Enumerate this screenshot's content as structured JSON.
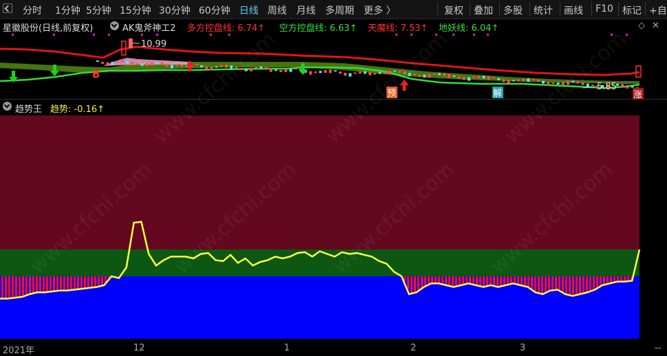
{
  "toolbar": {
    "left_items": [
      "分时",
      "1分钟",
      "5分钟",
      "15分钟",
      "30分钟",
      "60分钟",
      "日线",
      "周线",
      "月线",
      "多周期",
      "更多 〉"
    ],
    "active": "日线",
    "right_items": [
      "复权",
      "叠加",
      "多股",
      "统计",
      "画线",
      "F10",
      "标记",
      "+自"
    ]
  },
  "info": {
    "stock": "星徽股份(日线,前复权)",
    "indicator_name": "AK鬼斧神工2",
    "dfk_label": "多方控盘线: 6.74↑",
    "kfk_label": "空方控盘线: 6.63↑",
    "tmx_label": "天魔线: 7.53↑",
    "dyx_label": "地妖线: 6.04↑"
  },
  "price_annotations": {
    "high": "10.99",
    "low": "5.85",
    "buy_mark": "B",
    "pre_mark": "预",
    "jie_mark": "解",
    "zhang_mark": "涨"
  },
  "indicator": {
    "name": "趋势王",
    "value_label": "趋势: -0.16↑"
  },
  "axis": {
    "labels": [
      "2021年",
      "12",
      "1",
      "2",
      "3",
      "--"
    ]
  },
  "colors": {
    "zone_top": "#64081f",
    "zone_mid": "#0c5712",
    "zone_bottom": "#0000ff",
    "trend_line": "#ffff40",
    "tick_red": "#ff1010",
    "red_line": "#e01515",
    "green_line": "#33dd33"
  },
  "chart_data": {
    "type": "line",
    "series": [
      {
        "values": [
          -0.55,
          -0.55,
          -0.54,
          -0.53,
          -0.5,
          -0.48,
          -0.48,
          -0.47,
          -0.46,
          -0.46,
          -0.45,
          -0.44,
          -0.43,
          -0.42,
          -0.4,
          -0.3,
          -0.32,
          -0.2,
          0.3,
          0.31,
          -0.05,
          -0.18,
          -0.12,
          -0.08,
          -0.08,
          -0.08,
          -0.1,
          -0.05,
          -0.04,
          -0.12,
          -0.13,
          -0.06,
          -0.15,
          -0.1,
          -0.18,
          -0.14,
          -0.12,
          -0.08,
          -0.1,
          -0.08,
          -0.04,
          -0.03,
          -0.08,
          -0.02,
          -0.05,
          -0.08,
          -0.03,
          -0.05,
          -0.04,
          -0.06,
          -0.08,
          -0.13,
          -0.16,
          -0.25,
          -0.3,
          -0.5,
          -0.48,
          -0.42,
          -0.38,
          -0.38,
          -0.4,
          -0.42,
          -0.4,
          -0.38,
          -0.4,
          -0.42,
          -0.4,
          -0.42,
          -0.4,
          -0.38,
          -0.4,
          -0.42,
          -0.48,
          -0.5,
          -0.46,
          -0.45,
          -0.5,
          -0.52,
          -0.5,
          -0.48,
          -0.45,
          -0.4,
          -0.38,
          -0.36,
          -0.36,
          -0.35,
          0.0
        ]
      }
    ],
    "zones": [
      1.5,
      0.0,
      -0.3,
      -1.0
    ]
  }
}
